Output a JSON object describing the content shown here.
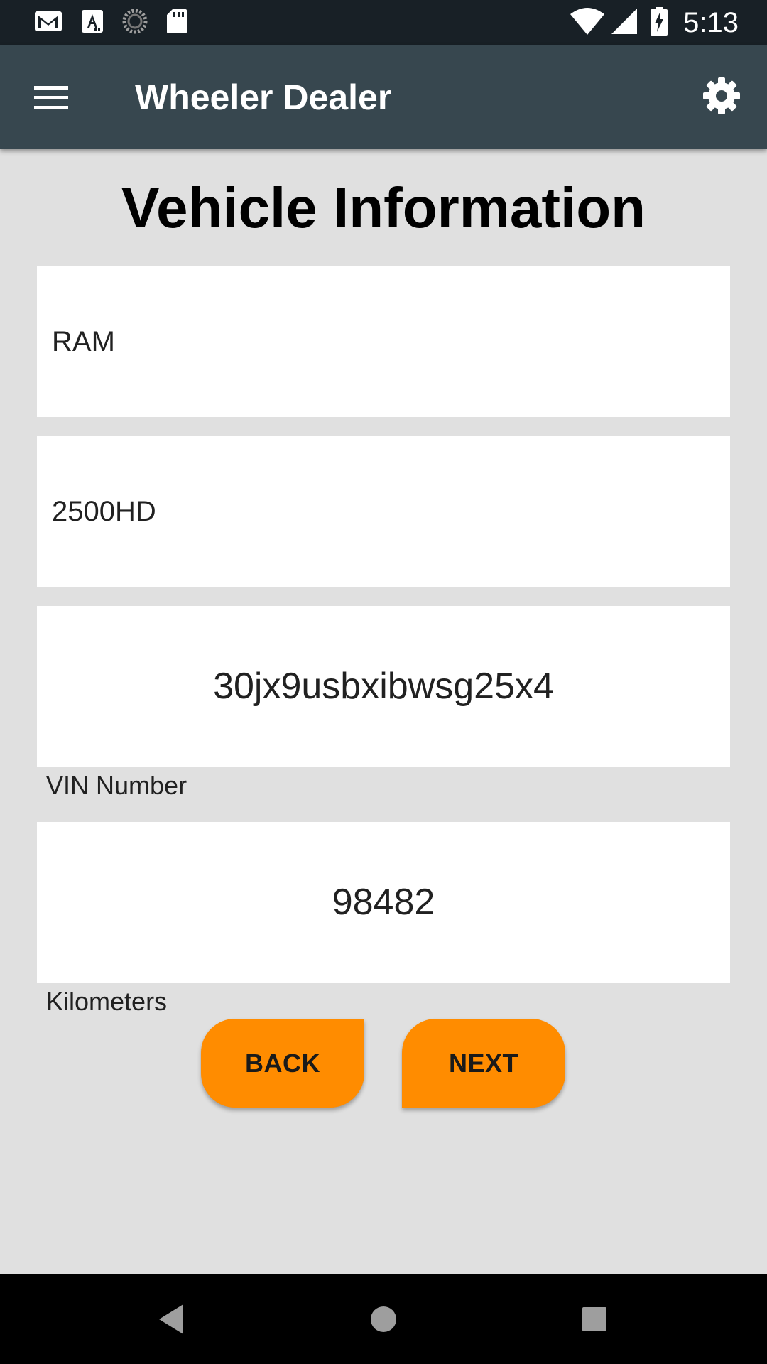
{
  "status_bar": {
    "time": "5:13",
    "icons_left": [
      "gmail-icon",
      "font-a-icon",
      "sync-progress-icon",
      "sd-card-icon"
    ],
    "icons_right": [
      "wifi-icon",
      "cell-signal-icon",
      "battery-charging-icon"
    ]
  },
  "app_bar": {
    "title": "Wheeler Dealer",
    "menu_icon": "hamburger-menu-icon",
    "settings_icon": "gear-icon"
  },
  "page": {
    "heading": "Vehicle Information"
  },
  "form": {
    "make_value": "RAM",
    "model_value": "2500HD",
    "vin_value": "30jx9usbxibwsg25x4",
    "vin_label": "VIN Number",
    "km_value": "98482",
    "km_label": "Kilometers"
  },
  "buttons": {
    "back": "BACK",
    "next": "NEXT"
  },
  "colors": {
    "status_bar": "#182026",
    "app_bar": "#37474f",
    "background": "#e0e0e0",
    "button": "#ff8c00"
  },
  "nav_bar": {
    "icons": [
      "back-triangle-icon",
      "home-circle-icon",
      "recents-square-icon"
    ]
  }
}
